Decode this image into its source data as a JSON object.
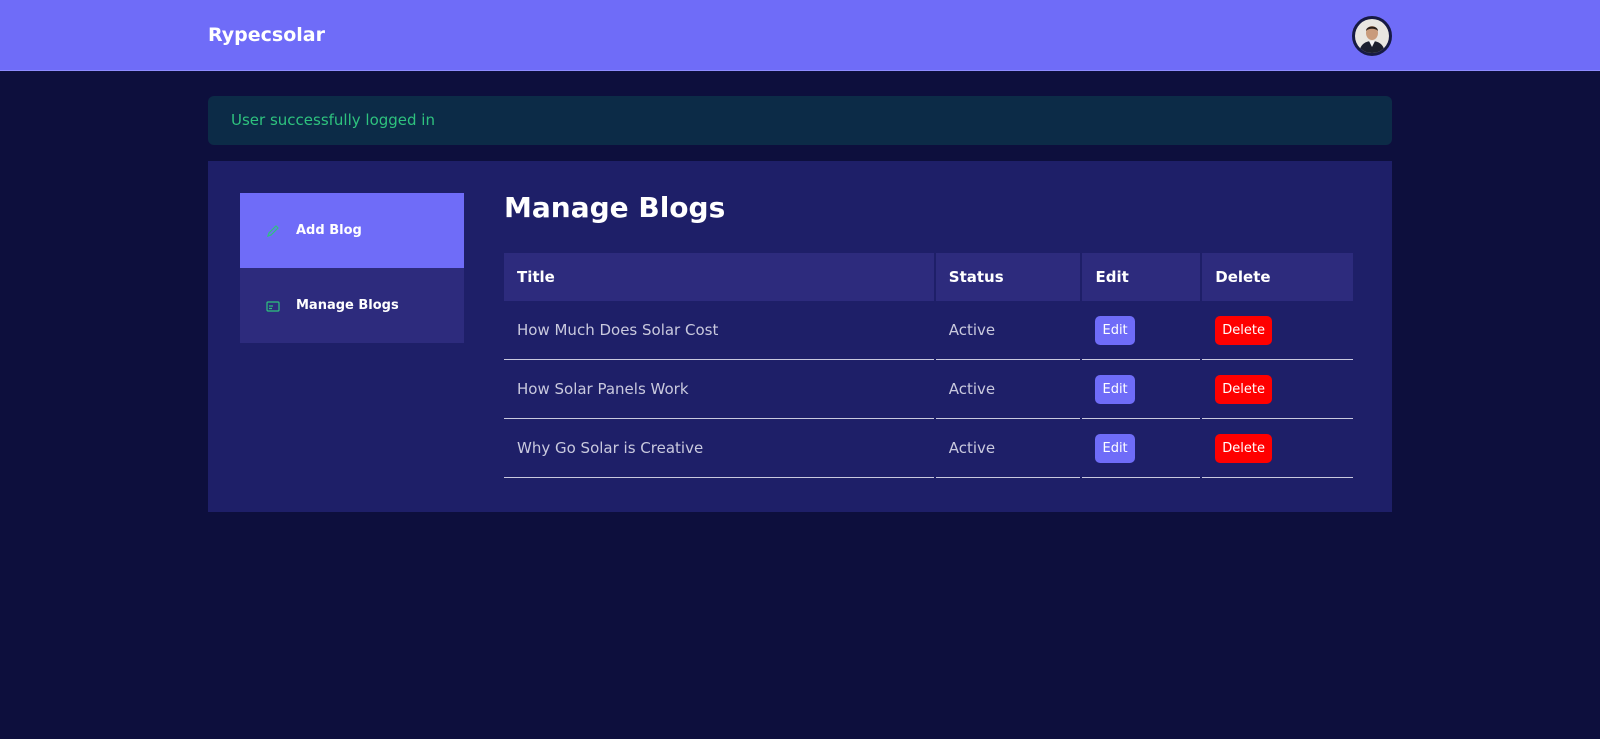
{
  "header": {
    "brand": "Rypecsolar",
    "avatar_icon": "user-avatar"
  },
  "alert": {
    "message": "User successfully logged in",
    "color": "#2ec27e"
  },
  "sidebar": {
    "items": [
      {
        "label": "Add Blog",
        "icon": "pencil-icon",
        "active": true
      },
      {
        "label": "Manage Blogs",
        "icon": "card-icon",
        "active": false
      }
    ]
  },
  "main": {
    "title": "Manage Blogs",
    "table": {
      "headers": [
        "Title",
        "Status",
        "Edit",
        "Delete"
      ],
      "rows": [
        {
          "title": "How Much Does Solar Cost",
          "status": "Active",
          "edit": "Edit",
          "delete": "Delete"
        },
        {
          "title": "How Solar Panels Work",
          "status": "Active",
          "edit": "Edit",
          "delete": "Delete"
        },
        {
          "title": "Why Go Solar is Creative",
          "status": "Active",
          "edit": "Edit",
          "delete": "Delete"
        }
      ]
    }
  },
  "colors": {
    "accent": "#6f6cf8",
    "background": "#0d0f3d",
    "panel": "#1e1f68",
    "danger": "#ff0000"
  }
}
